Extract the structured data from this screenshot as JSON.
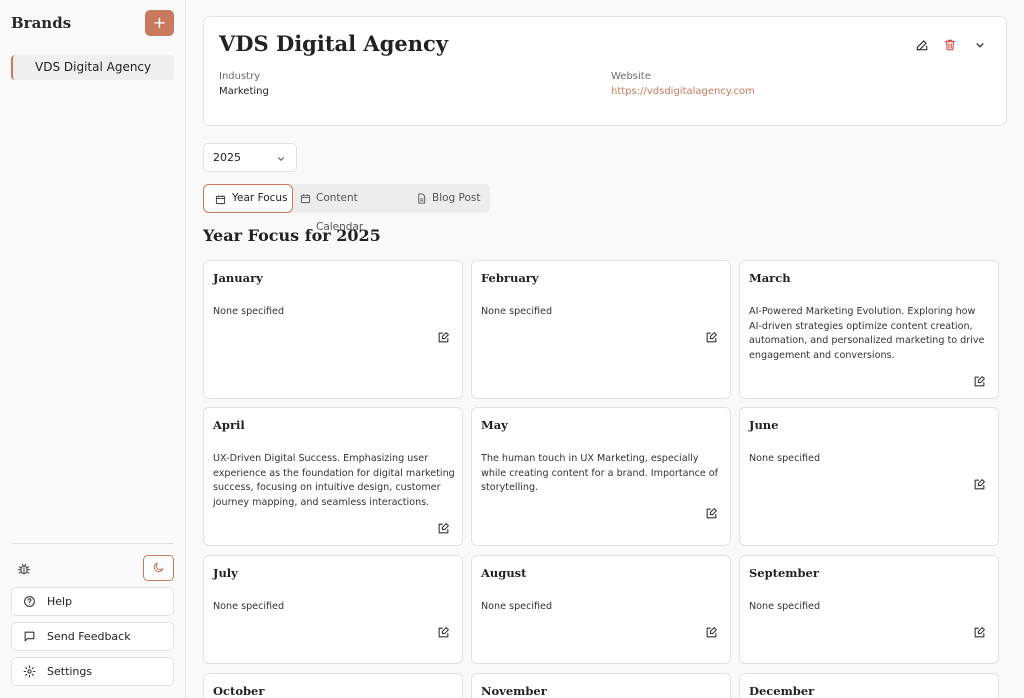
{
  "sidebar": {
    "title": "Brands",
    "add_label": "+",
    "brands": [
      "VDS Digital Agency"
    ],
    "help_label": "Help",
    "feedback_label": "Send Feedback",
    "settings_label": "Settings"
  },
  "brand": {
    "name": "VDS Digital Agency",
    "industry_label": "Industry",
    "industry_value": "Marketing",
    "website_label": "Website",
    "website_value": "https://vdsdigitalagency.com"
  },
  "year_select": {
    "value": "2025"
  },
  "tabs": [
    {
      "label": "Year Focus",
      "active": true
    },
    {
      "label": "Content Calendar",
      "active": false
    },
    {
      "label": "Blog Post",
      "active": false
    }
  ],
  "section_title": "Year Focus for 2025",
  "months": [
    {
      "name": "January",
      "focus": "None specified"
    },
    {
      "name": "February",
      "focus": "None specified"
    },
    {
      "name": "March",
      "focus": "AI-Powered Marketing Evolution. Exploring how AI-driven strategies optimize content creation, automation, and personalized marketing to drive engagement and conversions."
    },
    {
      "name": "April",
      "focus": "UX-Driven Digital Success. Emphasizing user experience as the foundation for digital marketing success, focusing on intuitive design, customer journey mapping, and seamless interactions."
    },
    {
      "name": "May",
      "focus": "The human touch in UX Marketing, especially while creating content for a brand. Importance of storytelling."
    },
    {
      "name": "June",
      "focus": "None specified"
    },
    {
      "name": "July",
      "focus": "None specified"
    },
    {
      "name": "August",
      "focus": "None specified"
    },
    {
      "name": "September",
      "focus": "None specified"
    },
    {
      "name": "October",
      "focus": ""
    },
    {
      "name": "November",
      "focus": ""
    },
    {
      "name": "December",
      "focus": ""
    }
  ],
  "colors": {
    "accent": "#c97a5e",
    "danger": "#d9534f"
  }
}
